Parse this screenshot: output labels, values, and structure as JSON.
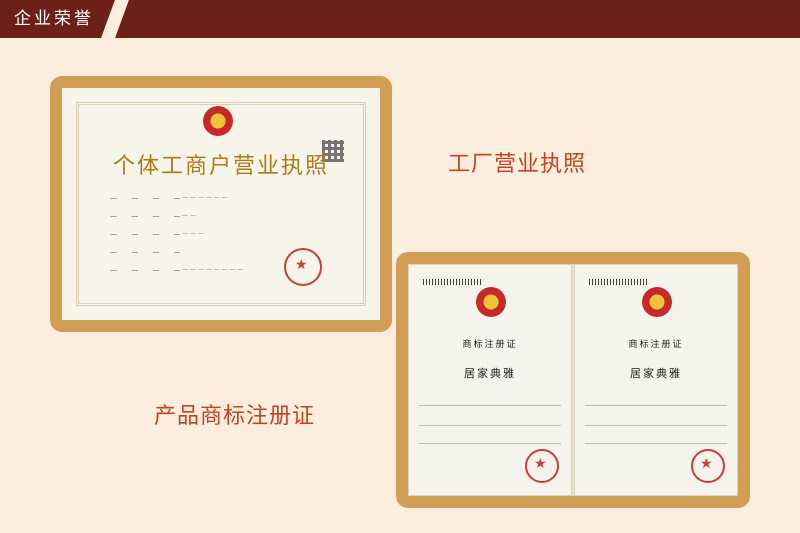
{
  "header": {
    "tab_label": "企业荣誉"
  },
  "captions": {
    "business_license": "工厂营业执照",
    "trademark": "产品商标注册证"
  },
  "license": {
    "title": "个体工商户营业执照"
  },
  "trademark": {
    "certificate_title": "商标注册证",
    "mark_name": "居家典雅"
  },
  "colors": {
    "header_bg": "#6d2116",
    "page_bg": "#fbeede",
    "frame": "#d29e55",
    "caption": "#c7421e"
  }
}
